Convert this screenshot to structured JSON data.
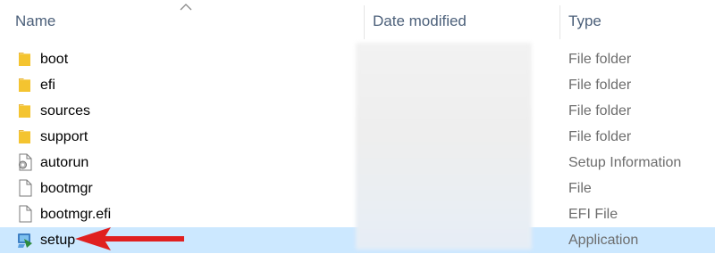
{
  "header": {
    "name_label": "Name",
    "date_label": "Date modified",
    "type_label": "Type",
    "sort_indicator": "sort-ascending-caret-icon"
  },
  "files": [
    {
      "name": "boot",
      "type": "File folder",
      "icon": "folder-icon"
    },
    {
      "name": "efi",
      "type": "File folder",
      "icon": "folder-icon"
    },
    {
      "name": "sources",
      "type": "File folder",
      "icon": "folder-icon"
    },
    {
      "name": "support",
      "type": "File folder",
      "icon": "folder-icon"
    },
    {
      "name": "autorun",
      "type": "Setup Information",
      "icon": "setup-information-icon"
    },
    {
      "name": "bootmgr",
      "type": "File",
      "icon": "file-icon"
    },
    {
      "name": "bootmgr.efi",
      "type": "EFI File",
      "icon": "file-icon"
    },
    {
      "name": "setup",
      "type": "Application",
      "icon": "setup-application-icon",
      "selected": true
    }
  ],
  "colors": {
    "selection": "#cce8ff",
    "header_text": "#4c607a",
    "type_text": "#6d6d6d",
    "folder": "#f4c430",
    "arrow": "#e02020"
  }
}
